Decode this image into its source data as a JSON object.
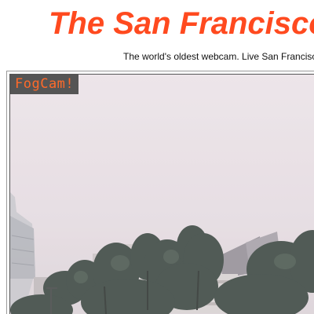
{
  "header": {
    "title": "The San Francisco",
    "tagline": "The world's oldest webcam. Live San Francisco"
  },
  "webcam": {
    "label": "FogCam!",
    "image_alt": "Foggy view of the campus with trees and buildings",
    "image_icon": "webcam-image",
    "label_color": "#ff6a2a"
  },
  "colors": {
    "title": "#ff4a1f",
    "sky": "#e9e2e6",
    "trees": "#2b3a34"
  }
}
